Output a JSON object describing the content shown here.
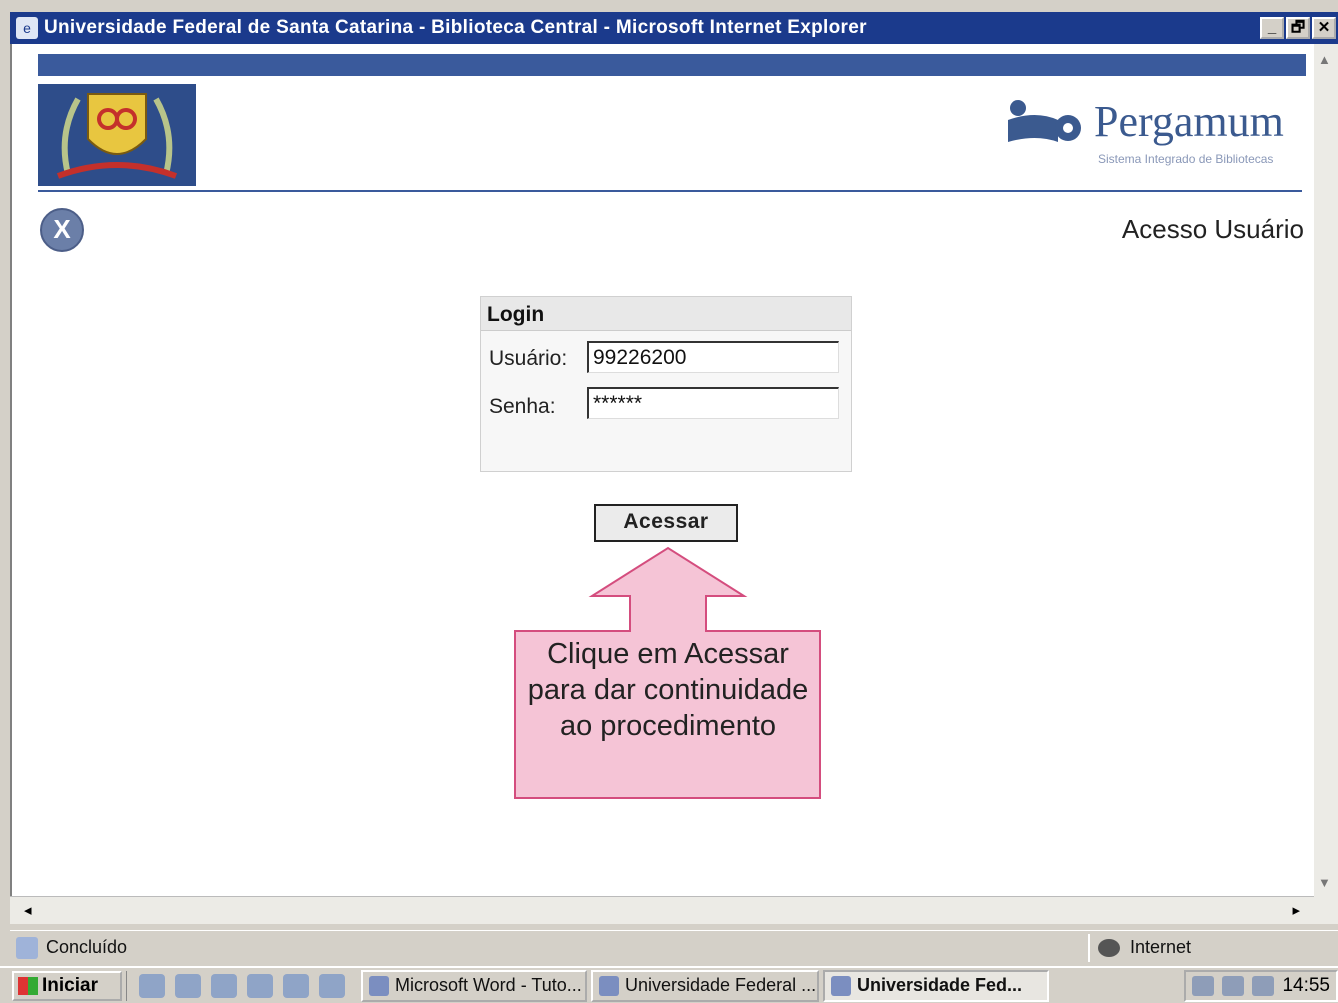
{
  "window": {
    "title": "Universidade Federal de Santa Catarina - Biblioteca Central - Microsoft Internet Explorer",
    "min_label": "_",
    "restore_label": "🗗",
    "close_label": "✕"
  },
  "header": {
    "brand_name": "Pergamum",
    "brand_subtitle": "Sistema Integrado de Bibliotecas",
    "close_label": "X",
    "page_title": "Acesso Usuário"
  },
  "login": {
    "heading": "Login",
    "user_label": "Usuário:",
    "user_value": "99226200",
    "pass_label": "Senha:",
    "pass_value": "******",
    "submit_label": "Acessar"
  },
  "callout": {
    "text": "Clique em Acessar para dar continuidade ao procedimento"
  },
  "status": {
    "text": "Concluído",
    "zone": "Internet"
  },
  "taskbar": {
    "start_label": "Iniciar",
    "tasks": [
      "Microsoft Word - Tuto...",
      "Universidade Federal ...",
      "Universidade Fed..."
    ],
    "clock": "14:55"
  },
  "colors": {
    "titlebar": "#1b3a8c",
    "header_band": "#3a5a9c",
    "callout_fill": "#f5c4d6",
    "callout_border": "#d44d7e"
  }
}
